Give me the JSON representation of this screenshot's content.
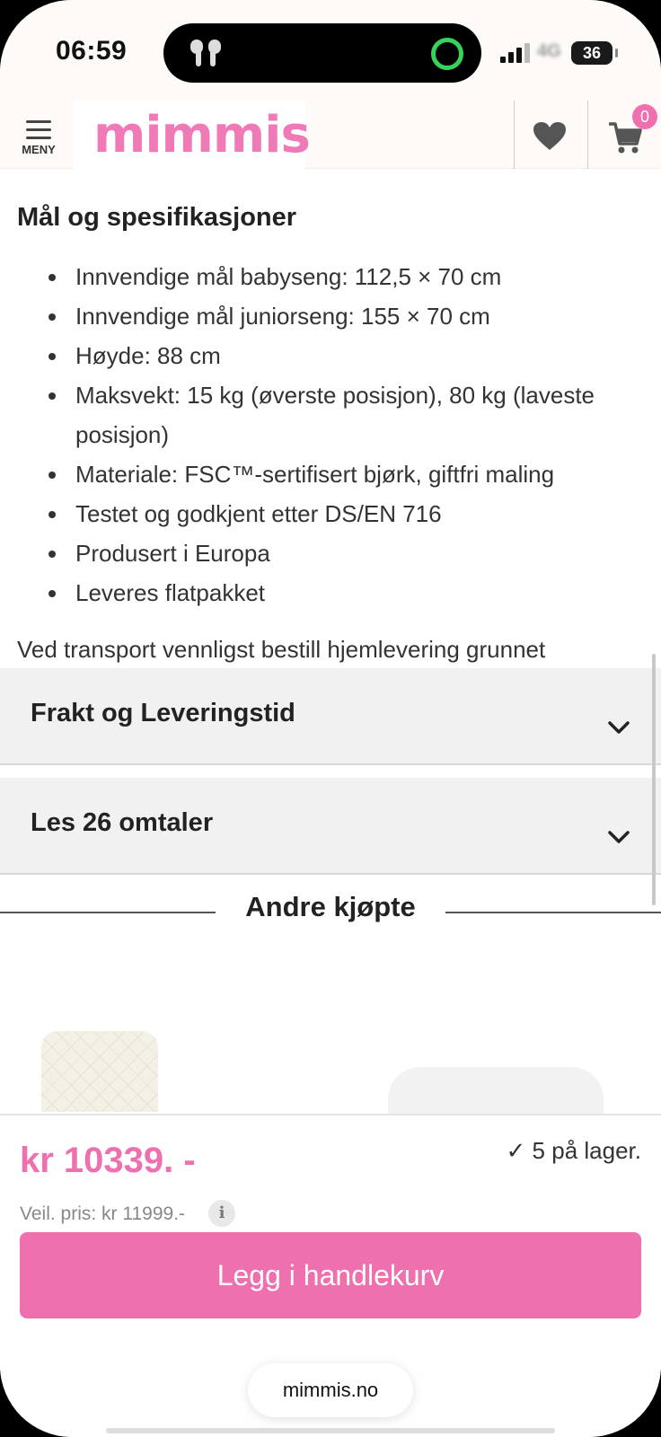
{
  "status_bar": {
    "time": "06:59",
    "network": "4G",
    "battery": "36"
  },
  "header": {
    "menu_label": "MENY",
    "logo_text": "mimmis",
    "cart_count": "0"
  },
  "specs": {
    "title": "Mål og spesifikasjoner",
    "items": [
      "Innvendige mål babyseng: 112,5 × 70 cm",
      "Innvendige mål juniorseng: 155 × 70 cm",
      "Høyde: 88 cm",
      "Maksvekt: 15 kg (øverste posisjon), 80 kg (laveste posisjon)",
      "Materiale: FSC™-sertifisert bjørk, giftfri maling",
      "Testet og godkjent etter DS/EN 716",
      "Produsert i Europa",
      "Leveres flatpakket"
    ],
    "transport_note": "Ved transport vennligst bestill hjemlevering grunnet"
  },
  "accordions": [
    {
      "title": "Frakt og Leveringstid"
    },
    {
      "title": "Les 26 omtaler"
    }
  ],
  "related": {
    "title": "Andre kjøpte"
  },
  "buy": {
    "price": "kr 10339. -",
    "stock": "✓ 5 på lager.",
    "recommended_price": "Veil. pris: kr 11999.-",
    "add_to_cart": "Legg i handlekurv"
  },
  "browser": {
    "url": "mimmis.no"
  },
  "colors": {
    "brand_pink": "#ee70ae",
    "accordion_bg": "#f1f1f1"
  }
}
